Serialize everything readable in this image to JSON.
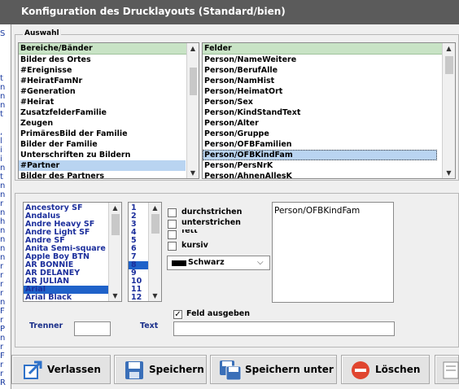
{
  "window": {
    "title": "Konfiguration des Drucklayouts (Standard/bien)"
  },
  "background_chars": [
    "S",
    "",
    "",
    "",
    "",
    "t",
    "n",
    "n",
    "n",
    "t",
    "",
    ",",
    "l",
    "i",
    "i",
    "n",
    "t",
    "n",
    "n",
    "r",
    "n",
    "h",
    "n",
    "n",
    "n",
    "n",
    "r",
    "r",
    "r",
    "r",
    "n",
    "F",
    "r",
    "P",
    "n",
    "r",
    "F",
    "r",
    "r",
    "R"
  ],
  "auswahl": {
    "label": "Auswahl",
    "bereiche": {
      "header": "Bereiche/Bänder",
      "items": [
        "Bilder des Ortes",
        "#Ereignisse",
        "#HeiratFamNr",
        "#Generation",
        "#Heirat",
        "ZusatzfelderFamilie",
        "Zeugen",
        "PrimäresBild der Familie",
        "Bilder der Familie",
        "Unterschriften zu Bildern",
        "#Partner",
        "Bilder des Partners"
      ],
      "selected_index": 10
    },
    "felder": {
      "header": "Felder",
      "items": [
        "Person/NameWeitere",
        "Person/BerufAlle",
        "Person/NamHist",
        "Person/HeimatOrt",
        "Person/Sex",
        "Person/KindStandText",
        "Person/Alter",
        "Person/Gruppe",
        "Person/OFBFamilien",
        "Person/OFBKindFam",
        "Person/PersNrK",
        "Person/AhnenAllesK"
      ],
      "selected_index": 9
    }
  },
  "format": {
    "fonts": [
      "Ancestory SF",
      "Andalus",
      "Andre Heavy SF",
      "Andre Light SF",
      "Andre SF",
      "Anita  Semi-square",
      "Apple Boy BTN",
      "AR BONNIE",
      "AR DELANEY",
      "AR JULIAN",
      "Arial",
      "Arial Black"
    ],
    "font_selected_index": 10,
    "sizes": [
      "1",
      "2",
      "3",
      "4",
      "5",
      "6",
      "7",
      "8",
      "9",
      "10",
      "11",
      "12"
    ],
    "size_selected_index": 7,
    "checkboxes": {
      "durchstrichen": "durchstrichen",
      "unterstrichen": "unterstrichen",
      "fett": "fett",
      "kursiv": "kursiv"
    },
    "color": {
      "label": "Schwarz",
      "swatch": "#000000"
    },
    "preview_text": "Person/OFBKindFam",
    "feld_ausgeben": {
      "label": "Feld ausgeben",
      "checked": true
    },
    "trenner_label": "Trenner",
    "trenner_value": "",
    "text_label": "Text",
    "text_value": ""
  },
  "buttons": {
    "verlassen": "Verlassen",
    "speichern": "Speichern",
    "speichern_unter": "Speichern unter",
    "loeschen": "Löschen"
  }
}
